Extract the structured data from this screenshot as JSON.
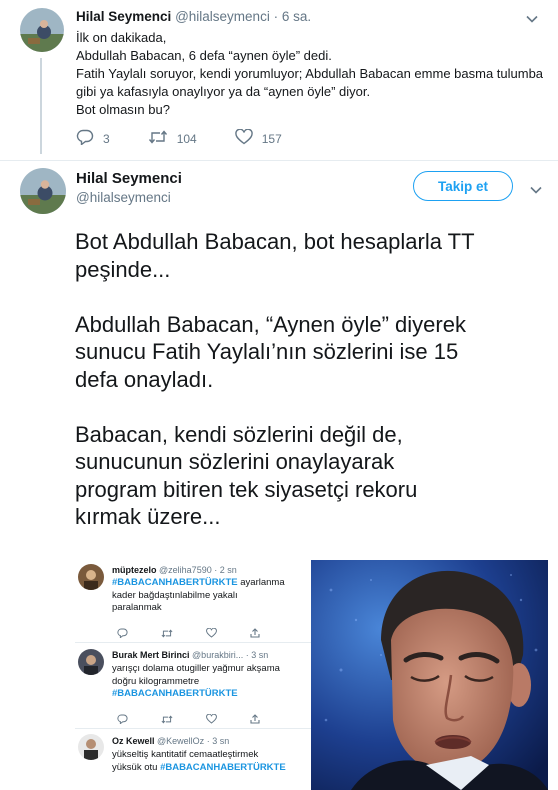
{
  "reply_tweet": {
    "name": "Hilal Seymenci",
    "handle": "@hilalseymenci",
    "time": " · 6 sa.",
    "lines": [
      "İlk on dakikada,",
      "Abdullah Babacan, 6 defa “aynen öyle” dedi.",
      "Fatih Yaylalı soruyor, kendi yorumluyor; Abdullah Babacan emme basma tulumba",
      "gibi ya kafasıyla onaylıyor ya da “aynen öyle” diyor.",
      "Bot olmasın bu?"
    ],
    "counts": {
      "replies": "3",
      "retweets": "104",
      "likes": "157"
    }
  },
  "main_tweet": {
    "name": "Hilal Seymenci",
    "handle": "@hilalseymenci",
    "follow_label": "Takip et",
    "paragraphs": [
      [
        "Bot Abdullah Babacan, bot hesaplarla TT",
        "peşinde..."
      ],
      [
        "Abdullah Babacan, “Aynen öyle” diyerek",
        "sunucu Fatih Yaylalı’nın sözlerini  ise 15",
        "defa onayladı."
      ],
      [
        "Babacan, kendi sözlerini değil de,",
        "sunucunun sözlerini onaylayarak",
        "program bitiren tek siyasetçi rekoru",
        "kırmak üzere..."
      ]
    ]
  },
  "embedded": {
    "tweets": [
      {
        "name": "müptezelo",
        "handle": "@zeliha7590",
        "time": "· 2 sn",
        "hashtag": "#BABACANHABERTÜRKTE",
        "line1_rest": " ayarlanma",
        "line2": "kader bağdaştınlabilme yakalı",
        "line3": "paralanmak"
      },
      {
        "name": "Burak Mert Birinci",
        "handle": "@burakbiri...",
        "time": "· 3 sn",
        "line1": "yarışçı dolama otugiller yağmur akşama",
        "line2": "doğru kilogrammetre",
        "hashtag": "#BABACANHABERTÜRKTE"
      },
      {
        "name": "Oz Kewell",
        "handle": "@KewellOz",
        "time": "· 3 sn",
        "line1": "yükseltiş kantitatif cemaatleştirmek",
        "line2_pre": "yüksük otu ",
        "hashtag": "#BABACANHABERTÜRKTE"
      }
    ]
  },
  "colors": {
    "accent": "#1da1f2",
    "text": "#14171a",
    "muted": "#657786",
    "hashtag": "#1b95e0"
  },
  "icons": [
    "chevron-down-icon",
    "reply-icon",
    "retweet-icon",
    "like-icon",
    "share-icon"
  ]
}
